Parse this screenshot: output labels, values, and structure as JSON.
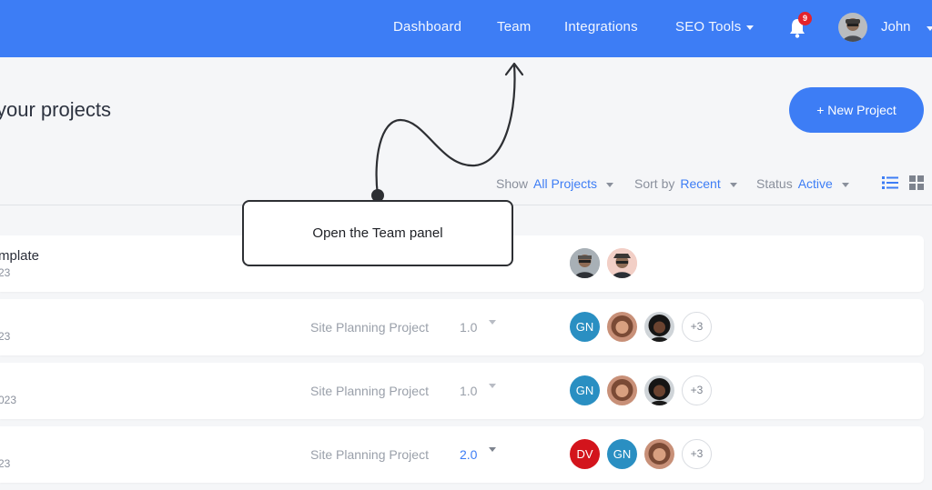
{
  "nav": {
    "items": [
      {
        "label": "Dashboard"
      },
      {
        "label": "Team"
      },
      {
        "label": "Integrations"
      },
      {
        "label": "SEO Tools"
      }
    ],
    "notifications_count": "9",
    "user_name": "John"
  },
  "page": {
    "title": "your projects",
    "new_project_label": "+ New Project"
  },
  "filters": {
    "show_label": "Show",
    "show_value": "All Projects",
    "sort_label": "Sort by",
    "sort_value": "Recent",
    "status_label": "Status",
    "status_value": "Active"
  },
  "rows": [
    {
      "name": "mplate",
      "date": "23",
      "type": "",
      "version": "",
      "members": [
        "photo-male-1",
        "photo-male-2"
      ]
    },
    {
      "name": "",
      "date": "23",
      "type": "Site Planning Project",
      "version": "1.0",
      "members": [
        "GN",
        "photo-female-1",
        "photo-female-2"
      ],
      "more": "+3"
    },
    {
      "name": "",
      "date": "023",
      "type": "Site Planning Project",
      "version": "1.0",
      "members": [
        "GN",
        "photo-female-1",
        "photo-female-2"
      ],
      "more": "+3"
    },
    {
      "name": "",
      "date": "23",
      "type": "Site Planning Project",
      "version": "2.0",
      "members": [
        "DV",
        "GN",
        "photo-female-1"
      ],
      "more": "+3"
    }
  ],
  "callout": {
    "text": "Open the Team panel"
  },
  "colors": {
    "accent": "#3d7df5",
    "badge": "#e4232c",
    "avatar_gn": "#2a8fc2",
    "avatar_dv": "#d3141c"
  }
}
